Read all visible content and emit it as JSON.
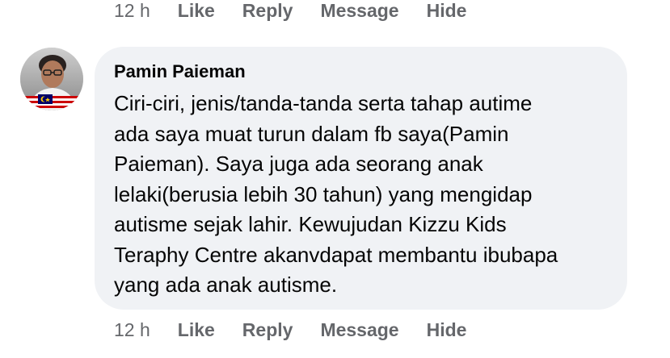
{
  "top_actions": {
    "time": "12 h",
    "like": "Like",
    "reply": "Reply",
    "message": "Message",
    "hide": "Hide"
  },
  "comment": {
    "author": "Pamin Paieman",
    "lines": [
      "Ciri-ciri, jenis/tanda-tanda serta tahap autime",
      "ada saya muat turun dalam fb saya(Pamin",
      "Paieman). Saya juga ada seorang anak",
      "lelaki(berusia lebih 30 tahun) yang mengidap",
      "autisme sejak lahir. Kewujudan Kizzu Kids",
      "Teraphy Centre akanvdapat membantu ibubapa",
      "yang ada anak autisme."
    ],
    "avatar_icon": "profile-photo"
  },
  "bottom_actions": {
    "time": "12 h",
    "like": "Like",
    "reply": "Reply",
    "message": "Message",
    "hide": "Hide"
  },
  "colors": {
    "bubble": "#f0f2f5",
    "meta_text": "#65676b",
    "body_text": "#050505"
  }
}
